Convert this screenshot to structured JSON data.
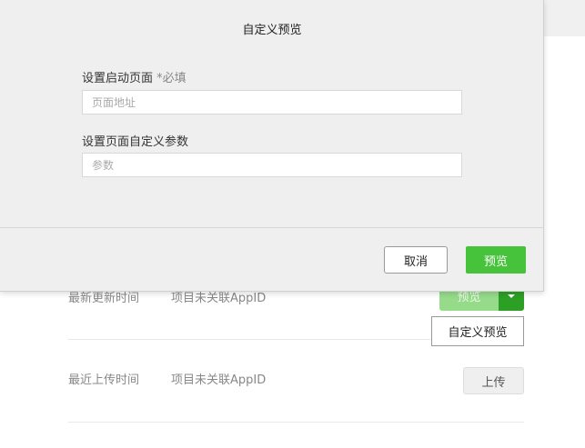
{
  "background": {
    "rows": [
      {
        "label": "最新更新时间",
        "value": "项目未关联AppID"
      },
      {
        "label": "最近上传时间",
        "value": "项目未关联AppID"
      }
    ],
    "preview_button": "预览",
    "dropdown_item": "自定义预览",
    "upload_button": "上传"
  },
  "dialog": {
    "title": "自定义预览",
    "start_page_label": "设置启动页面",
    "required_mark": "*必填",
    "start_page_placeholder": "页面地址",
    "params_label": "设置页面自定义参数",
    "params_placeholder": "参数",
    "cancel_label": "取消",
    "confirm_label": "预览"
  },
  "colors": {
    "primary": "#47c23b",
    "primary_disabled": "#95db8a",
    "primary_dark": "#2ba024"
  }
}
